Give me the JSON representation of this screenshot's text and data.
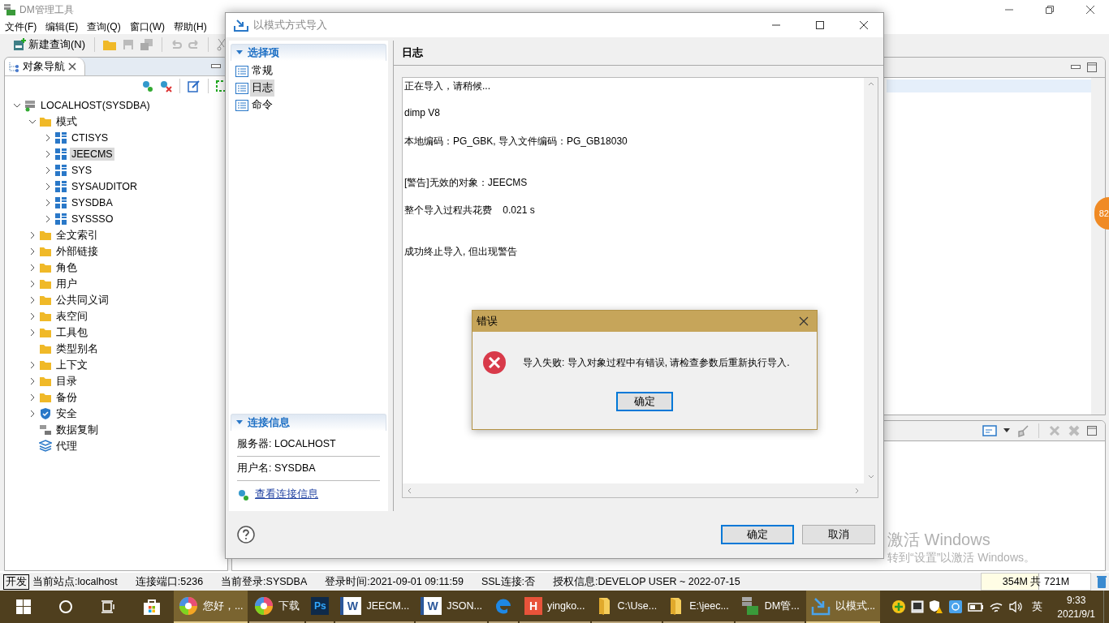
{
  "app": {
    "title": "DM管理工具",
    "menu": [
      "文件(F)",
      "编辑(E)",
      "查询(Q)",
      "窗口(W)",
      "帮助(H)"
    ],
    "new_query": "新建查询(N)"
  },
  "navigator": {
    "tab": "对象导航",
    "tree": [
      {
        "label": "LOCALHOST(SYSDBA)",
        "kind": "server",
        "expanded": true,
        "selected": false,
        "children": [
          {
            "label": "模式",
            "kind": "folder",
            "expanded": true,
            "selected": false,
            "children": [
              {
                "label": "CTISYS",
                "kind": "schema",
                "expanded": false,
                "selected": false
              },
              {
                "label": "JEECMS",
                "kind": "schema",
                "expanded": false,
                "selected": true
              },
              {
                "label": "SYS",
                "kind": "schema",
                "expanded": false,
                "selected": false
              },
              {
                "label": "SYSAUDITOR",
                "kind": "schema",
                "expanded": false,
                "selected": false
              },
              {
                "label": "SYSDBA",
                "kind": "schema",
                "expanded": false,
                "selected": false
              },
              {
                "label": "SYSSSO",
                "kind": "schema",
                "expanded": false,
                "selected": false
              }
            ]
          },
          {
            "label": "全文索引",
            "kind": "folder",
            "expanded": false,
            "selected": false
          },
          {
            "label": "外部链接",
            "kind": "folder",
            "expanded": false,
            "selected": false
          },
          {
            "label": "角色",
            "kind": "folder",
            "expanded": false,
            "selected": false
          },
          {
            "label": "用户",
            "kind": "folder",
            "expanded": false,
            "selected": false
          },
          {
            "label": "公共同义词",
            "kind": "folder",
            "expanded": false,
            "selected": false
          },
          {
            "label": "表空间",
            "kind": "folder",
            "expanded": false,
            "selected": false
          },
          {
            "label": "工具包",
            "kind": "folder",
            "expanded": false,
            "selected": false
          },
          {
            "label": "类型别名",
            "kind": "folder",
            "selected": false
          },
          {
            "label": "上下文",
            "kind": "folder",
            "expanded": false,
            "selected": false
          },
          {
            "label": "目录",
            "kind": "folder",
            "expanded": false,
            "selected": false
          },
          {
            "label": "备份",
            "kind": "folder",
            "expanded": false,
            "selected": false
          },
          {
            "label": "安全",
            "kind": "shield",
            "expanded": false,
            "selected": false
          },
          {
            "label": "数据复制",
            "kind": "replication",
            "selected": false
          },
          {
            "label": "代理",
            "kind": "layers",
            "selected": false
          }
        ]
      }
    ]
  },
  "import_dialog": {
    "title": "以模式方式导入",
    "options_section": "选择项",
    "options": [
      {
        "label": "常规",
        "selected": false
      },
      {
        "label": "日志",
        "selected": true
      },
      {
        "label": "命令",
        "selected": false
      }
    ],
    "connection_section": "连接信息",
    "connection": [
      "服务器: LOCALHOST",
      "用户名: SYSDBA"
    ],
    "connection_link": "查看连接信息",
    "heading": "日志",
    "log": [
      [
        "正在导入，请稍候...",
        "dimp V8",
        "本地编码：PG_GBK, 导入文件编码：PG_GB18030"
      ],
      [
        "[警告]无效的对象：JEECMS",
        "整个导入过程共花费    0.021 s"
      ],
      [
        "成功终止导入, 但出现警告"
      ]
    ],
    "ok": "确定",
    "cancel": "取消"
  },
  "error_dialog": {
    "title": "错误",
    "message": "导入失败: 导入对象过程中有错误, 请检查参数后重新执行导入.",
    "ok": "确定"
  },
  "badge": "82",
  "watermark": {
    "title": "激活 Windows",
    "hint": "转到“设置”以激活 Windows。"
  },
  "status_bar": {
    "mode": "开发",
    "items": [
      "当前站点:localhost",
      "连接端口:5236",
      "当前登录:SYSDBA",
      "登录时间:2021-09-01 09:11:59",
      "SSL连接:否",
      "授权信息:DEVELOP USER ~ 2022-07-15"
    ],
    "memory": {
      "text": "354M 共 721M",
      "level": 0.52
    }
  },
  "taskbar": {
    "apps": [
      {
        "kind": "browser",
        "label": "您好，...",
        "selected": true
      },
      {
        "kind": "browser",
        "label": "下载",
        "selected": false
      },
      {
        "kind": "ps",
        "glyph": "Ps",
        "selected": false
      },
      {
        "kind": "word",
        "glyph": "W",
        "label": "JEECM...",
        "selected": false
      },
      {
        "kind": "word",
        "glyph": "W",
        "label": "JSON...",
        "selected": false
      },
      {
        "kind": "edge",
        "selected": false
      },
      {
        "kind": "hicon",
        "glyph": "H",
        "label": "yingko...",
        "selected": false
      },
      {
        "kind": "folder",
        "label": "C:\\Use...",
        "selected": false
      },
      {
        "kind": "folder",
        "label": "E:\\jeec...",
        "selected": false
      },
      {
        "kind": "dm",
        "label": "DM管...",
        "selected": false
      },
      {
        "kind": "import",
        "label": "以模式...",
        "selected": true
      }
    ],
    "ime": "英",
    "time": "9:33",
    "date": "2021/9/1"
  }
}
